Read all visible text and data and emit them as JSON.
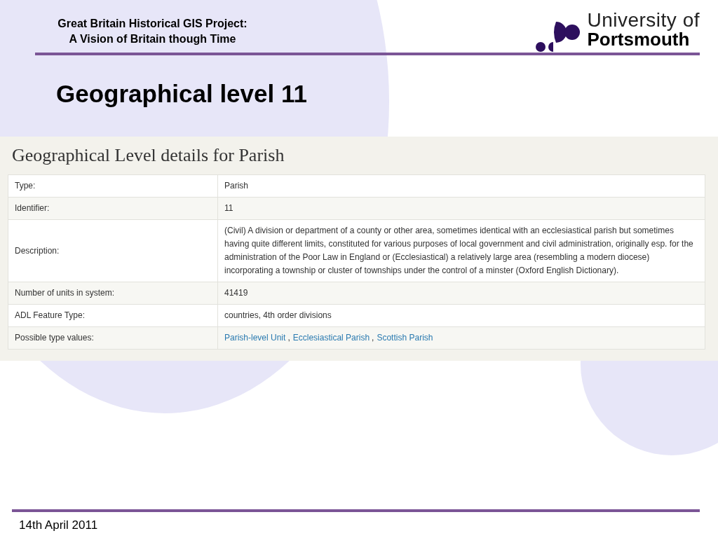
{
  "header": {
    "project_lines": [
      "Great Britain Historical GIS Project:",
      "A Vision of Britain though Time"
    ],
    "logo": {
      "line_1": "University of",
      "line_2": "Portsmouth"
    }
  },
  "slide_title": "Geographical level 11",
  "screenshot": {
    "heading": "Geographical Level details for Parish",
    "rows": [
      {
        "kind": "text",
        "label": "Type:",
        "value": "Parish"
      },
      {
        "kind": "text",
        "label": "Identifier:",
        "value": "11"
      },
      {
        "kind": "text",
        "label": "Description:",
        "value": "(Civil) A division or department of a county or other area, sometimes identical with an ecclesiastical parish but sometimes having quite different limits, constituted for various purposes of local government and civil administration, originally esp. for the administration of the Poor Law in England or (Ecclesiastical) a relatively large area (resembling a modern diocese) incorporating a township or cluster of townships under the control of a minster (Oxford English Dictionary)."
      },
      {
        "kind": "text",
        "label": "Number of units in system:",
        "value": "41419"
      },
      {
        "kind": "text",
        "label": "ADL Feature Type:",
        "value": "countries, 4th order divisions"
      },
      {
        "kind": "links",
        "label": "Possible type values:",
        "links": [
          "Parish-level Unit",
          "Ecclesiastical Parish",
          "Scottish Parish"
        ],
        "separator": ","
      }
    ]
  },
  "footer": {
    "date": "14th April 2011"
  }
}
